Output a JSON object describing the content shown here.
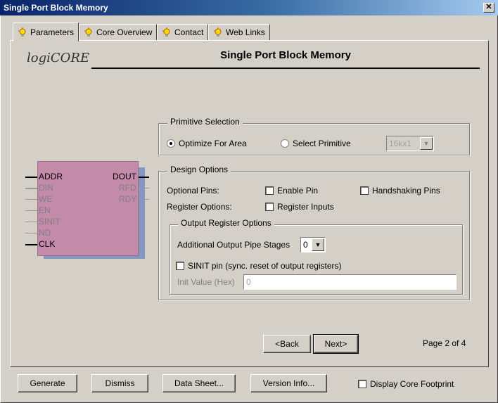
{
  "window": {
    "title": "Single Port Block Memory"
  },
  "tabs": [
    {
      "label": "Parameters"
    },
    {
      "label": "Core Overview"
    },
    {
      "label": "Contact"
    },
    {
      "label": "Web Links"
    }
  ],
  "logo": {
    "prefix": "logi",
    "suffix": "CORE"
  },
  "panel": {
    "title": "Single Port Block Memory"
  },
  "symbol": {
    "left_pins": [
      {
        "label": "ADDR",
        "active": true
      },
      {
        "label": "DIN",
        "active": false
      },
      {
        "label": "WE",
        "active": false
      },
      {
        "label": "EN",
        "active": false
      },
      {
        "label": "SINIT",
        "active": false
      },
      {
        "label": "ND",
        "active": false
      },
      {
        "label": "CLK",
        "active": true
      }
    ],
    "right_pins": [
      {
        "label": "DOUT",
        "active": true
      },
      {
        "label": "RFD",
        "active": false
      },
      {
        "label": "RDY",
        "active": false
      }
    ]
  },
  "primitive_selection": {
    "label": "Primitive Selection",
    "optimize_area": "Optimize For Area",
    "select_primitive": "Select Primitive",
    "primitive_value": "16kx1",
    "selected": "optimize_area"
  },
  "design_options": {
    "label": "Design Options",
    "optional_pins_label": "Optional Pins:",
    "enable_pin": "Enable Pin",
    "handshaking_pins": "Handshaking Pins",
    "register_options_label": "Register Options:",
    "register_inputs": "Register Inputs"
  },
  "output_register_options": {
    "label": "Output Register Options",
    "pipe_stages_label": "Additional Output Pipe Stages",
    "pipe_stages_value": "0",
    "sinit_pin": "SINIT pin (sync. reset of output registers)",
    "init_value_label": "Init Value (Hex)",
    "init_value": "0"
  },
  "navigation": {
    "back": "<Back",
    "next": "Next>",
    "page_indicator": "Page 2 of 4"
  },
  "footer": {
    "generate": "Generate",
    "dismiss": "Dismiss",
    "data_sheet": "Data Sheet...",
    "version_info": "Version Info...",
    "display_footprint": "Display Core Footprint"
  },
  "colors": {
    "titlebar_start": "#0a246a",
    "dialog_bg": "#d4d0c8",
    "symbol_body": "#c48aa9",
    "symbol_shadow": "#8596c0",
    "logo_accent": "#ff6a00"
  }
}
